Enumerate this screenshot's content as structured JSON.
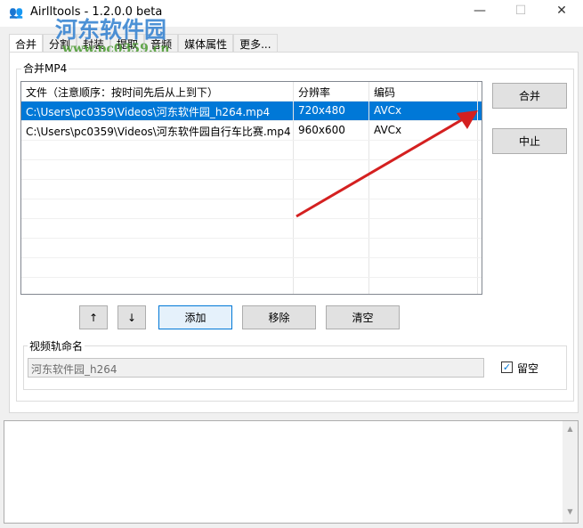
{
  "window": {
    "title": "Airlltools  -  1.2.0.0 beta",
    "minimize": "—",
    "maximize": "☐",
    "close": "✕"
  },
  "watermark": {
    "name": "河东软件园",
    "url": "www.pc0359.cn"
  },
  "tabs": [
    "合并",
    "分割",
    "封装",
    "提取",
    "音频",
    "媒体属性",
    "更多..."
  ],
  "group_merge": {
    "label": "合并MP4"
  },
  "table": {
    "headers": [
      "文件（注意顺序：按时间先后从上到下）",
      "分辨率",
      "编码"
    ],
    "rows": [
      [
        "C:\\Users\\pc0359\\Videos\\河东软件园_h264.mp4",
        "720x480",
        "AVCx"
      ],
      [
        "C:\\Users\\pc0359\\Videos\\河东软件园自行车比赛.mp4",
        "960x600",
        "AVCx"
      ]
    ]
  },
  "buttons": {
    "merge": "合并",
    "stop": "中止",
    "up": "↑",
    "down": "↓",
    "add": "添加",
    "remove": "移除",
    "clear": "清空"
  },
  "track": {
    "label": "视频轨命名",
    "value": "河东软件园_h264",
    "checkbox_label": "留空",
    "checked": true
  },
  "colors": {
    "selection": "#0078d7",
    "arrow": "#d42020"
  }
}
